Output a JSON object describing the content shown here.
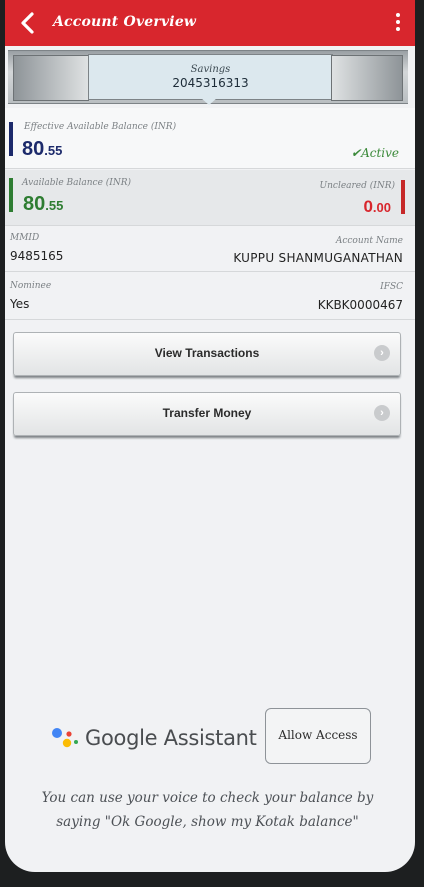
{
  "header": {
    "title": "Account Overview"
  },
  "account": {
    "type": "Savings",
    "number": "2045316313"
  },
  "effective_balance": {
    "label": "Effective Available Balance (INR)",
    "whole": "80",
    "decimal": ".55",
    "status": "Active"
  },
  "available_balance": {
    "label": "Available Balance (INR)",
    "whole": "80",
    "decimal": ".55"
  },
  "uncleared": {
    "label": "Uncleared (INR)",
    "whole": "0",
    "decimal": ".00"
  },
  "mmid": {
    "label": "MMID",
    "value": "9485165"
  },
  "account_name": {
    "label": "Account Name",
    "value": "KUPPU SHANMUGANATHAN"
  },
  "nominee": {
    "label": "Nominee",
    "value": "Yes"
  },
  "ifsc": {
    "label": "IFSC",
    "value": "KKBK0000467"
  },
  "actions": {
    "view_transactions": "View Transactions",
    "transfer_money": "Transfer Money"
  },
  "assistant": {
    "brand": "Google Assistant",
    "allow_label": "Allow Access",
    "hint": "You can use your voice to check your balance by saying \"Ok Google, show my Kotak balance\""
  },
  "colors": {
    "brand_red": "#d8262d",
    "balance_blue": "#1c2a6b",
    "balance_green": "#2e7d32",
    "active_green": "#3b8a3a"
  }
}
